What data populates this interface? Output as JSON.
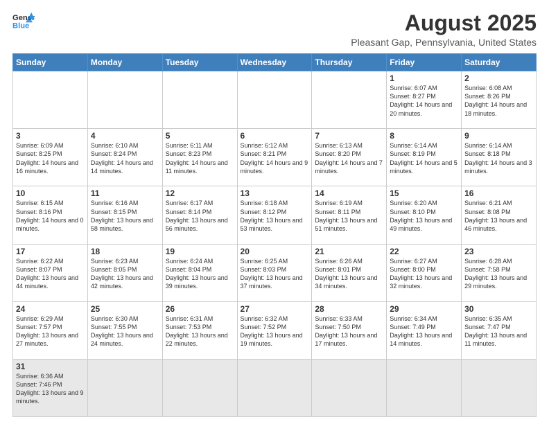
{
  "logo": {
    "line1": "General",
    "line2": "Blue"
  },
  "title": "August 2025",
  "subtitle": "Pleasant Gap, Pennsylvania, United States",
  "days_of_week": [
    "Sunday",
    "Monday",
    "Tuesday",
    "Wednesday",
    "Thursday",
    "Friday",
    "Saturday"
  ],
  "weeks": [
    [
      {
        "day": "",
        "info": ""
      },
      {
        "day": "",
        "info": ""
      },
      {
        "day": "",
        "info": ""
      },
      {
        "day": "",
        "info": ""
      },
      {
        "day": "",
        "info": ""
      },
      {
        "day": "1",
        "info": "Sunrise: 6:07 AM\nSunset: 8:27 PM\nDaylight: 14 hours and 20 minutes."
      },
      {
        "day": "2",
        "info": "Sunrise: 6:08 AM\nSunset: 8:26 PM\nDaylight: 14 hours and 18 minutes."
      }
    ],
    [
      {
        "day": "3",
        "info": "Sunrise: 6:09 AM\nSunset: 8:25 PM\nDaylight: 14 hours and 16 minutes."
      },
      {
        "day": "4",
        "info": "Sunrise: 6:10 AM\nSunset: 8:24 PM\nDaylight: 14 hours and 14 minutes."
      },
      {
        "day": "5",
        "info": "Sunrise: 6:11 AM\nSunset: 8:23 PM\nDaylight: 14 hours and 11 minutes."
      },
      {
        "day": "6",
        "info": "Sunrise: 6:12 AM\nSunset: 8:21 PM\nDaylight: 14 hours and 9 minutes."
      },
      {
        "day": "7",
        "info": "Sunrise: 6:13 AM\nSunset: 8:20 PM\nDaylight: 14 hours and 7 minutes."
      },
      {
        "day": "8",
        "info": "Sunrise: 6:14 AM\nSunset: 8:19 PM\nDaylight: 14 hours and 5 minutes."
      },
      {
        "day": "9",
        "info": "Sunrise: 6:14 AM\nSunset: 8:18 PM\nDaylight: 14 hours and 3 minutes."
      }
    ],
    [
      {
        "day": "10",
        "info": "Sunrise: 6:15 AM\nSunset: 8:16 PM\nDaylight: 14 hours and 0 minutes."
      },
      {
        "day": "11",
        "info": "Sunrise: 6:16 AM\nSunset: 8:15 PM\nDaylight: 13 hours and 58 minutes."
      },
      {
        "day": "12",
        "info": "Sunrise: 6:17 AM\nSunset: 8:14 PM\nDaylight: 13 hours and 56 minutes."
      },
      {
        "day": "13",
        "info": "Sunrise: 6:18 AM\nSunset: 8:12 PM\nDaylight: 13 hours and 53 minutes."
      },
      {
        "day": "14",
        "info": "Sunrise: 6:19 AM\nSunset: 8:11 PM\nDaylight: 13 hours and 51 minutes."
      },
      {
        "day": "15",
        "info": "Sunrise: 6:20 AM\nSunset: 8:10 PM\nDaylight: 13 hours and 49 minutes."
      },
      {
        "day": "16",
        "info": "Sunrise: 6:21 AM\nSunset: 8:08 PM\nDaylight: 13 hours and 46 minutes."
      }
    ],
    [
      {
        "day": "17",
        "info": "Sunrise: 6:22 AM\nSunset: 8:07 PM\nDaylight: 13 hours and 44 minutes."
      },
      {
        "day": "18",
        "info": "Sunrise: 6:23 AM\nSunset: 8:05 PM\nDaylight: 13 hours and 42 minutes."
      },
      {
        "day": "19",
        "info": "Sunrise: 6:24 AM\nSunset: 8:04 PM\nDaylight: 13 hours and 39 minutes."
      },
      {
        "day": "20",
        "info": "Sunrise: 6:25 AM\nSunset: 8:03 PM\nDaylight: 13 hours and 37 minutes."
      },
      {
        "day": "21",
        "info": "Sunrise: 6:26 AM\nSunset: 8:01 PM\nDaylight: 13 hours and 34 minutes."
      },
      {
        "day": "22",
        "info": "Sunrise: 6:27 AM\nSunset: 8:00 PM\nDaylight: 13 hours and 32 minutes."
      },
      {
        "day": "23",
        "info": "Sunrise: 6:28 AM\nSunset: 7:58 PM\nDaylight: 13 hours and 29 minutes."
      }
    ],
    [
      {
        "day": "24",
        "info": "Sunrise: 6:29 AM\nSunset: 7:57 PM\nDaylight: 13 hours and 27 minutes."
      },
      {
        "day": "25",
        "info": "Sunrise: 6:30 AM\nSunset: 7:55 PM\nDaylight: 13 hours and 24 minutes."
      },
      {
        "day": "26",
        "info": "Sunrise: 6:31 AM\nSunset: 7:53 PM\nDaylight: 13 hours and 22 minutes."
      },
      {
        "day": "27",
        "info": "Sunrise: 6:32 AM\nSunset: 7:52 PM\nDaylight: 13 hours and 19 minutes."
      },
      {
        "day": "28",
        "info": "Sunrise: 6:33 AM\nSunset: 7:50 PM\nDaylight: 13 hours and 17 minutes."
      },
      {
        "day": "29",
        "info": "Sunrise: 6:34 AM\nSunset: 7:49 PM\nDaylight: 13 hours and 14 minutes."
      },
      {
        "day": "30",
        "info": "Sunrise: 6:35 AM\nSunset: 7:47 PM\nDaylight: 13 hours and 11 minutes."
      }
    ],
    [
      {
        "day": "31",
        "info": "Sunrise: 6:36 AM\nSunset: 7:46 PM\nDaylight: 13 hours and 9 minutes."
      },
      {
        "day": "",
        "info": ""
      },
      {
        "day": "",
        "info": ""
      },
      {
        "day": "",
        "info": ""
      },
      {
        "day": "",
        "info": ""
      },
      {
        "day": "",
        "info": ""
      },
      {
        "day": "",
        "info": ""
      }
    ]
  ]
}
